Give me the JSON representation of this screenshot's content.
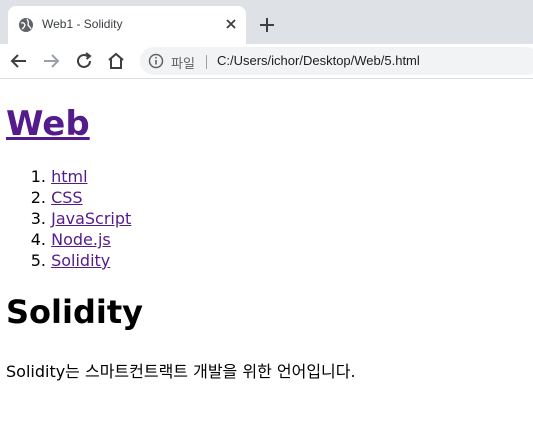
{
  "browser": {
    "tab_title": "Web1 - Solidity",
    "omnibox": {
      "origin_label": "파일",
      "url": "C:/Users/ichor/Desktop/Web/5.html"
    }
  },
  "page": {
    "site_title": "Web",
    "nav_items": [
      {
        "number": "1.",
        "label": "html"
      },
      {
        "number": "2.",
        "label": "CSS"
      },
      {
        "number": "3.",
        "label": "JavaScript"
      },
      {
        "number": "4.",
        "label": "Node.js"
      },
      {
        "number": "5.",
        "label": "Solidity"
      }
    ],
    "heading": "Solidity",
    "body_text": "Solidity는 스마트컨트랙트 개발을 위한 언어입니다."
  },
  "colors": {
    "tabstrip_bg": "#dee1e6",
    "link_visited": "#551a8b",
    "omnibox_bg": "#f1f3f4"
  },
  "icons": [
    "globe-icon",
    "close-icon",
    "plus-icon",
    "back-arrow-icon",
    "forward-arrow-icon",
    "reload-icon",
    "home-icon",
    "info-icon"
  ]
}
